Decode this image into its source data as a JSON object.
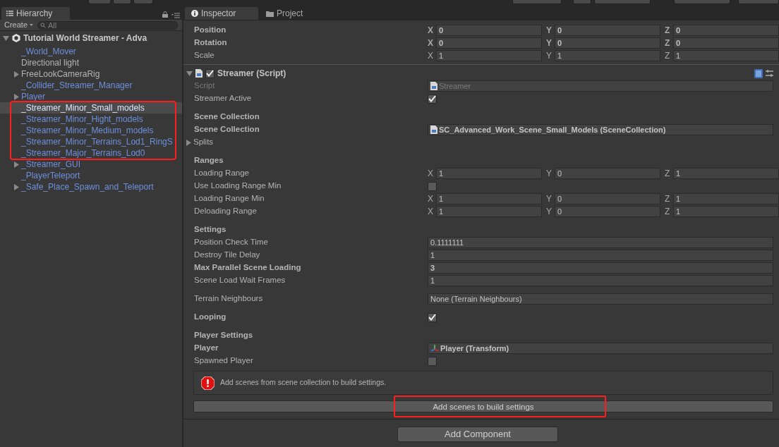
{
  "hierarchy": {
    "tab": {
      "label": "Hierarchy",
      "selected": true
    },
    "create_button": "Create",
    "search": {
      "placeholder": "All"
    },
    "scene": {
      "name": "Tutorial World Streamer - Adva",
      "expanded": true
    },
    "items": [
      {
        "name": "_World_Mover",
        "prefab": true,
        "has_children": false,
        "selected": false,
        "annotated": false
      },
      {
        "name": "Directional light",
        "prefab": false,
        "has_children": false,
        "selected": false,
        "annotated": false
      },
      {
        "name": "FreeLookCameraRig",
        "prefab": false,
        "has_children": true,
        "selected": false,
        "annotated": false
      },
      {
        "name": "_Collider_Streamer_Manager",
        "prefab": true,
        "has_children": false,
        "selected": false,
        "annotated": false
      },
      {
        "name": "Player",
        "prefab": true,
        "has_children": true,
        "selected": false,
        "annotated": false
      },
      {
        "name": "_Streamer_Minor_Small_models",
        "prefab": true,
        "has_children": false,
        "selected": true,
        "annotated": true
      },
      {
        "name": "_Streamer_Minor_Hight_models",
        "prefab": true,
        "has_children": false,
        "selected": false,
        "annotated": true
      },
      {
        "name": "_Streamer_Minor_Medium_models",
        "prefab": true,
        "has_children": false,
        "selected": false,
        "annotated": true
      },
      {
        "name": "_Streamer_Minor_Terrains_Lod1_RingS",
        "prefab": true,
        "has_children": false,
        "selected": false,
        "annotated": true
      },
      {
        "name": "_Streamer_Major_Terrains_Lod0",
        "prefab": true,
        "has_children": false,
        "selected": false,
        "annotated": true
      },
      {
        "name": "_Streamer_GUI",
        "prefab": true,
        "has_children": true,
        "selected": false,
        "annotated": false
      },
      {
        "name": "_PlayerTeleport",
        "prefab": true,
        "has_children": false,
        "selected": false,
        "annotated": false
      },
      {
        "name": "_Safe_Place_Spawn_and_Teleport",
        "prefab": true,
        "has_children": true,
        "selected": false,
        "annotated": false
      }
    ]
  },
  "inspector": {
    "tabs": [
      {
        "label": "Inspector",
        "kind": "info",
        "selected": true
      },
      {
        "label": "Project",
        "kind": "folder",
        "selected": false
      }
    ],
    "transform_rows": [
      {
        "label": "Position",
        "bold": true,
        "fields": [
          {
            "axis": "X",
            "value": "0"
          },
          {
            "axis": "Y",
            "value": "0"
          },
          {
            "axis": "Z",
            "value": "0"
          }
        ]
      },
      {
        "label": "Rotation",
        "bold": true,
        "fields": [
          {
            "axis": "X",
            "value": "0"
          },
          {
            "axis": "Y",
            "value": "0"
          },
          {
            "axis": "Z",
            "value": "0"
          }
        ]
      },
      {
        "label": "Scale",
        "bold": false,
        "fields": [
          {
            "axis": "X",
            "value": "1"
          },
          {
            "axis": "Y",
            "value": "1"
          },
          {
            "axis": "Z",
            "value": "1"
          }
        ]
      }
    ],
    "component": {
      "title": "Streamer (Script)",
      "enabled": true,
      "expanded": true,
      "sections": [
        [
          {
            "kind": "script_field",
            "label": "Script",
            "value": "Streamer",
            "disabled": true,
            "bold": false
          },
          {
            "kind": "checkbox",
            "label": "Streamer Active",
            "checked": true,
            "bold": false
          }
        ],
        [
          {
            "kind": "header",
            "label": "Scene Collection"
          },
          {
            "kind": "asset_field",
            "label": "Scene Collection",
            "value": "SC_Advanced_Work_Scene_Small_Models (SceneCollection)",
            "disabled": false,
            "bold": true
          },
          {
            "kind": "foldout",
            "label": "Splits",
            "expanded": false
          }
        ],
        [
          {
            "kind": "header",
            "label": "Ranges"
          },
          {
            "kind": "vector3",
            "label": "Loading Range",
            "bold": false,
            "fields": [
              {
                "axis": "X",
                "value": "1"
              },
              {
                "axis": "Y",
                "value": "0"
              },
              {
                "axis": "Z",
                "value": "1"
              }
            ]
          },
          {
            "kind": "checkbox",
            "label": "Use Loading Range Min",
            "checked": false,
            "bold": false
          },
          {
            "kind": "vector3",
            "label": "Loading Range Min",
            "bold": false,
            "fields": [
              {
                "axis": "X",
                "value": "1"
              },
              {
                "axis": "Y",
                "value": "0"
              },
              {
                "axis": "Z",
                "value": "1"
              }
            ]
          },
          {
            "kind": "vector3",
            "label": "Deloading Range",
            "bold": false,
            "fields": [
              {
                "axis": "X",
                "value": "1"
              },
              {
                "axis": "Y",
                "value": "0"
              },
              {
                "axis": "Z",
                "value": "1"
              }
            ]
          }
        ],
        [
          {
            "kind": "header",
            "label": "Settings"
          },
          {
            "kind": "text",
            "label": "Position Check Time",
            "value": "0.1111111",
            "bold": false
          },
          {
            "kind": "text",
            "label": "Destroy Tile Delay",
            "value": "1",
            "bold": false
          },
          {
            "kind": "text",
            "label": "Max Parallel Scene Loading",
            "value": "3",
            "bold": true
          },
          {
            "kind": "text",
            "label": "Scene Load Wait Frames",
            "value": "1",
            "bold": false
          }
        ],
        [
          {
            "kind": "empty_field",
            "label": "Terrain Neighbours",
            "value": "None (Terrain Neighbours)",
            "disabled": false,
            "bold": false
          }
        ],
        [
          {
            "kind": "checkbox",
            "label": "Looping",
            "checked": true,
            "bold": true
          }
        ],
        [
          {
            "kind": "header",
            "label": "Player Settings"
          },
          {
            "kind": "transform_field",
            "label": "Player",
            "value": "Player (Transform)",
            "disabled": false,
            "bold": true
          },
          {
            "kind": "checkbox",
            "label": "Spawned Player",
            "checked": false,
            "bold": false
          }
        ]
      ],
      "help": {
        "kind": "error",
        "message": "Add scenes from scene collection to build settings."
      },
      "action_button": {
        "label": "Add scenes to build settings",
        "annotated": true
      }
    },
    "add_component": "Add Component"
  }
}
